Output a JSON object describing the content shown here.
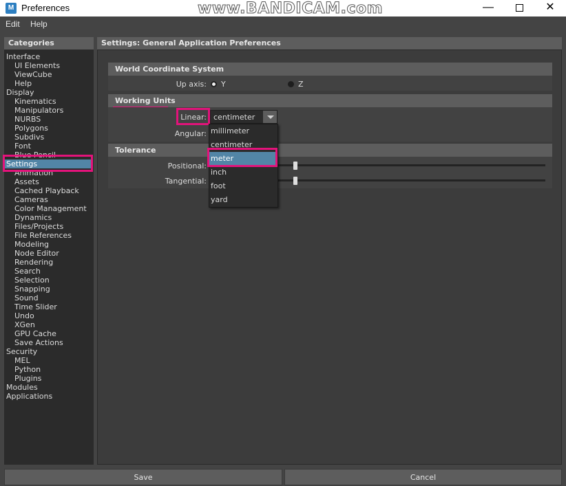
{
  "window": {
    "title": "Preferences",
    "icon_letter": "M",
    "watermark": "www.BANDICAM.com",
    "minimize": "—",
    "close": "✕"
  },
  "menu": {
    "edit": "Edit",
    "help": "Help"
  },
  "categories": {
    "header": "Categories",
    "items": [
      {
        "label": "Interface",
        "level": 0
      },
      {
        "label": "UI Elements",
        "level": 1
      },
      {
        "label": "ViewCube",
        "level": 1
      },
      {
        "label": "Help",
        "level": 1
      },
      {
        "label": "Display",
        "level": 0
      },
      {
        "label": "Kinematics",
        "level": 1
      },
      {
        "label": "Manipulators",
        "level": 1
      },
      {
        "label": "NURBS",
        "level": 1
      },
      {
        "label": "Polygons",
        "level": 1
      },
      {
        "label": "Subdivs",
        "level": 1
      },
      {
        "label": "Font",
        "level": 1
      },
      {
        "label": "Blue Pencil",
        "level": 1
      },
      {
        "label": "Settings",
        "level": 0,
        "selected": true
      },
      {
        "label": "Animation",
        "level": 1
      },
      {
        "label": "Assets",
        "level": 1
      },
      {
        "label": "Cached Playback",
        "level": 1
      },
      {
        "label": "Cameras",
        "level": 1
      },
      {
        "label": "Color Management",
        "level": 1
      },
      {
        "label": "Dynamics",
        "level": 1
      },
      {
        "label": "Files/Projects",
        "level": 1
      },
      {
        "label": "File References",
        "level": 1
      },
      {
        "label": "Modeling",
        "level": 1
      },
      {
        "label": "Node Editor",
        "level": 1
      },
      {
        "label": "Rendering",
        "level": 1
      },
      {
        "label": "Search",
        "level": 1
      },
      {
        "label": "Selection",
        "level": 1
      },
      {
        "label": "Snapping",
        "level": 1
      },
      {
        "label": "Sound",
        "level": 1
      },
      {
        "label": "Time Slider",
        "level": 1
      },
      {
        "label": "Undo",
        "level": 1
      },
      {
        "label": "XGen",
        "level": 1
      },
      {
        "label": "GPU Cache",
        "level": 1
      },
      {
        "label": "Save Actions",
        "level": 1
      },
      {
        "label": "Security",
        "level": 0
      },
      {
        "label": "MEL",
        "level": 1
      },
      {
        "label": "Python",
        "level": 1
      },
      {
        "label": "Plugins",
        "level": 1
      },
      {
        "label": "Modules",
        "level": 0
      },
      {
        "label": "Applications",
        "level": 0
      }
    ]
  },
  "settings": {
    "header": "Settings: General Application Preferences",
    "world": {
      "title": "World Coordinate System",
      "up_axis_label": "Up axis:",
      "option_y": "Y",
      "option_z": "Z",
      "selected": "Y"
    },
    "units": {
      "title": "Working Units",
      "linear_label": "Linear:",
      "linear_value": "centimeter",
      "angular_label": "Angular:",
      "options": [
        "millimeter",
        "centimeter",
        "meter",
        "inch",
        "foot",
        "yard"
      ],
      "highlighted": "meter"
    },
    "tolerance": {
      "title": "Tolerance",
      "positional_label": "Positional:",
      "tangential_label": "Tangential:"
    }
  },
  "buttons": {
    "save": "Save",
    "cancel": "Cancel"
  },
  "colors": {
    "highlight": "#e3137b",
    "selection": "#5285a6"
  }
}
